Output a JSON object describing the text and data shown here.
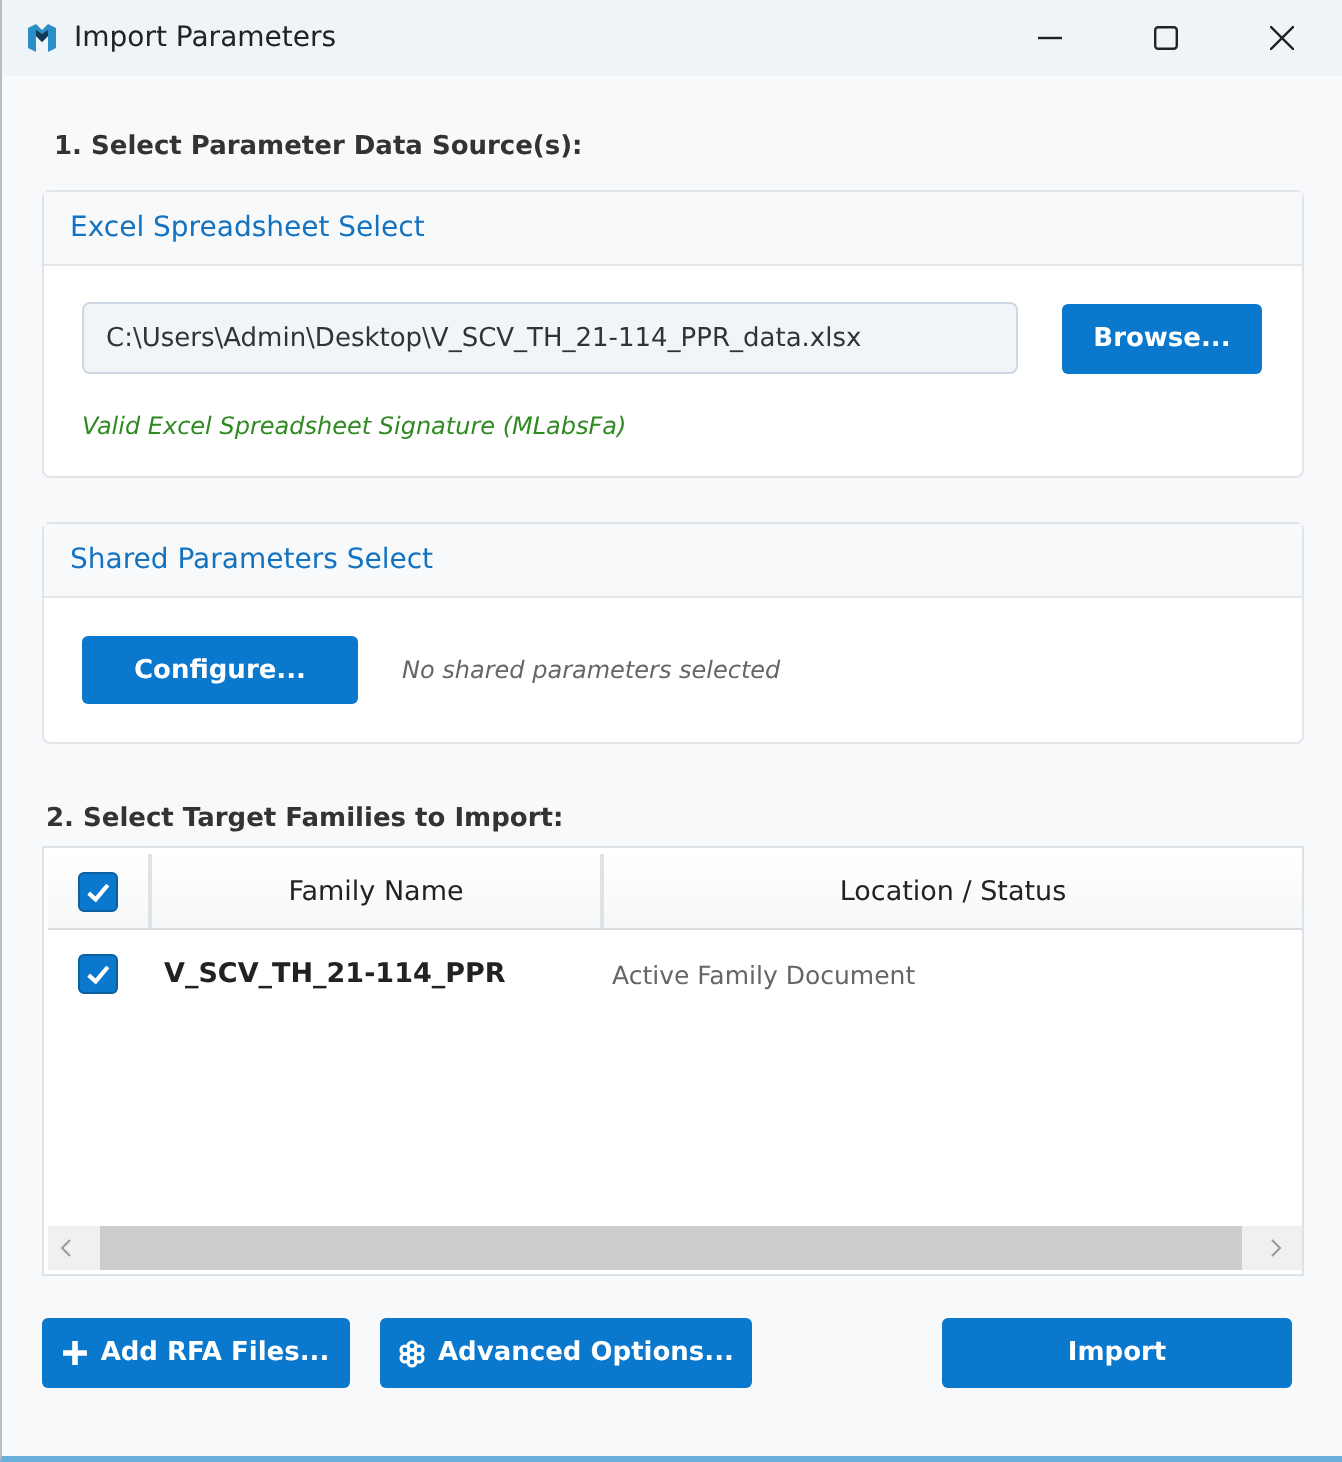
{
  "window": {
    "title": "Import Parameters"
  },
  "source_section": {
    "heading": "1. Select Parameter Data Source(s):"
  },
  "excel_card": {
    "title": "Excel Spreadsheet Select",
    "path_value": "C:\\Users\\Admin\\Desktop\\V_SCV_TH_21-114_PPR_data.xlsx",
    "browse_button": "Browse...",
    "status": "Valid Excel Spreadsheet Signature (MLabsFa)"
  },
  "shared_card": {
    "title": "Shared Parameters Select",
    "configure_button": "Configure...",
    "status": "No shared parameters selected"
  },
  "target_section": {
    "heading": "2. Select Target Families to Import:"
  },
  "table": {
    "select_all_checked": true,
    "columns": [
      "Family Name",
      "Location / Status"
    ],
    "rows": [
      {
        "checked": true,
        "family_name": "V_SCV_TH_21-114_PPR",
        "location_status": "Active Family Document"
      }
    ]
  },
  "buttons": [
    {
      "kind": "add",
      "label": "Add RFA Files..."
    },
    {
      "kind": "options",
      "label": "Advanced Options..."
    },
    {
      "kind": "primary",
      "label": "Import"
    }
  ]
}
